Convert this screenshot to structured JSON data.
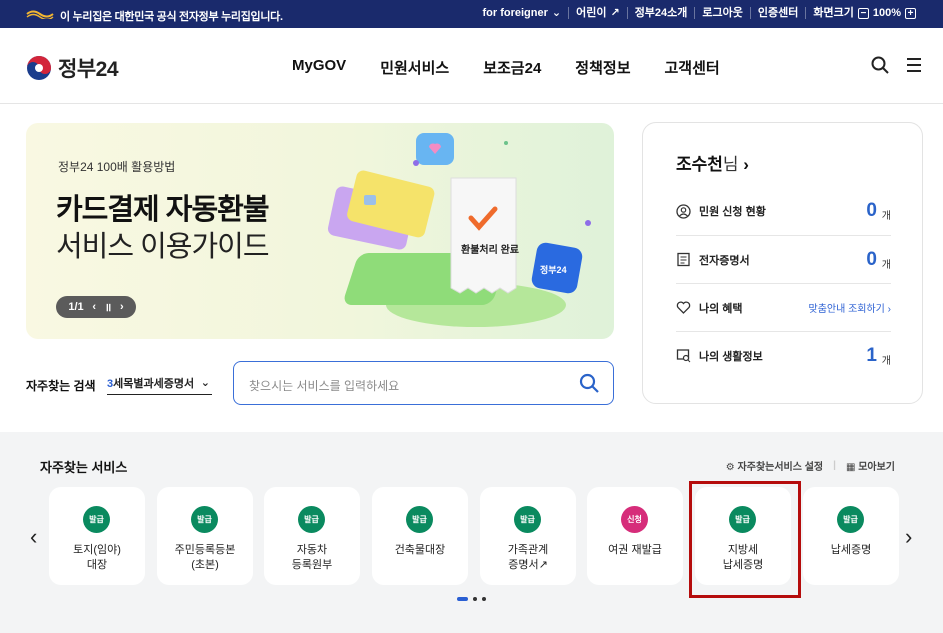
{
  "topbar": {
    "notice": "이 누리집은 대한민국 공식 전자정부 누리집입니다.",
    "links": [
      "for foreigner",
      "어린이",
      "정부24소개",
      "로그아웃",
      "인증센터",
      "화면크기"
    ],
    "zoom": "100%"
  },
  "header": {
    "brand": "정부24",
    "menu": [
      "MyGOV",
      "민원서비스",
      "보조금24",
      "정책정보",
      "고객센터"
    ]
  },
  "banner": {
    "eyebrow": "정부24 100배 활용방법",
    "title_bold": "카드결제 자동환불",
    "title_light": "서비스 이용가이드",
    "pager": "1/1",
    "art_text": "환불처리 완료",
    "art_badge": "정부24"
  },
  "search": {
    "frequent_label": "자주찾는 검색",
    "frequent_num": "3",
    "frequent_value": "세목별과세증명서",
    "placeholder": "찾으시는 서비스를 입력하세요"
  },
  "user": {
    "name": "조수천",
    "suffix": "님",
    "rows": [
      {
        "label": "민원 신청 현황",
        "value": "0",
        "unit": "개"
      },
      {
        "label": "전자증명서",
        "value": "0",
        "unit": "개"
      },
      {
        "label": "나의 혜택",
        "link": "맞춤안내 조회하기"
      },
      {
        "label": "나의 생활정보",
        "value": "1",
        "unit": "개"
      }
    ]
  },
  "services": {
    "title": "자주찾는 서비스",
    "setting": "자주찾는서비스 설정",
    "more": "모아보기",
    "cards": [
      {
        "badge": "발급",
        "l1": "토지(임야)",
        "l2": "대장"
      },
      {
        "badge": "발급",
        "l1": "주민등록등본",
        "l2": "(초본)"
      },
      {
        "badge": "발급",
        "l1": "자동차",
        "l2": "등록원부"
      },
      {
        "badge": "발급",
        "l1": "건축물대장",
        "l2": ""
      },
      {
        "badge": "발급",
        "l1": "가족관계",
        "l2": "증명서"
      },
      {
        "badge": "신청",
        "l1": "여권 재발급",
        "l2": ""
      },
      {
        "badge": "발급",
        "l1": "지방세",
        "l2": "납세증명"
      },
      {
        "badge": "발급",
        "l1": "납세증명",
        "l2": ""
      }
    ]
  },
  "colors": {
    "navy": "#1a2a6c",
    "blue": "#2a5fd3",
    "green": "#0a8a5f",
    "pink": "#d62d7a",
    "highlight": "#b50c0c"
  }
}
